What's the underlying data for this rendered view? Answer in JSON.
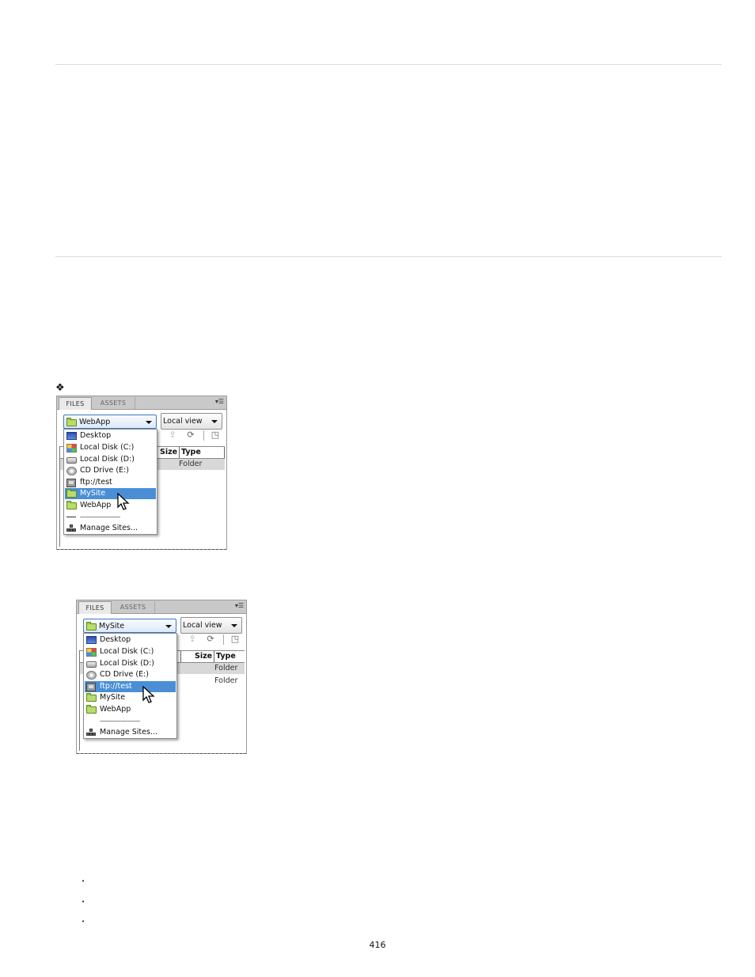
{
  "panel1": {
    "tab_files": "FILES",
    "tab_assets": "ASSETS",
    "site_value": "WebApp",
    "view_value": "Local view",
    "col_size": "Size",
    "col_type": "Type",
    "rows": [
      {
        "type": "Folder"
      }
    ],
    "dropdown": [
      {
        "label": "Desktop",
        "icon": "desktop-icon"
      },
      {
        "label": "Local Disk (C:)",
        "icon": "local-disk-icon"
      },
      {
        "label": "Local Disk (D:)",
        "icon": "local-disk-icon"
      },
      {
        "label": "CD Drive (E:)",
        "icon": "cd-drive-icon"
      },
      {
        "label": "ftp://test",
        "icon": "ftp-server-icon"
      },
      {
        "label": "MySite",
        "icon": "site-folder-icon",
        "highlighted": true
      },
      {
        "label": "WebApp",
        "icon": "site-folder-icon"
      }
    ],
    "separator": "-------------------------",
    "manage_sites": "Manage Sites..."
  },
  "panel2": {
    "tab_files": "FILES",
    "tab_assets": "ASSETS",
    "site_value": "MySite",
    "view_value": "Local view",
    "col_size": "Size",
    "col_type": "Type",
    "rows": [
      {
        "type": "Folder"
      },
      {
        "type": "Folder"
      }
    ],
    "dropdown": [
      {
        "label": "Desktop",
        "icon": "desktop-icon"
      },
      {
        "label": "Local Disk (C:)",
        "icon": "local-disk-icon"
      },
      {
        "label": "Local Disk (D:)",
        "icon": "local-disk-icon"
      },
      {
        "label": "CD Drive (E:)",
        "icon": "cd-drive-icon"
      },
      {
        "label": "ftp://test",
        "icon": "ftp-server-icon",
        "highlighted": true
      },
      {
        "label": "MySite",
        "icon": "site-folder-icon"
      },
      {
        "label": "WebApp",
        "icon": "site-folder-icon"
      }
    ],
    "separator": "-------------------------",
    "manage_sites": "Manage Sites..."
  },
  "colors": {
    "highlight": "#4a8fd6",
    "rule": "#dcdcdc"
  },
  "marker": "❖",
  "bullet": "•",
  "page_number": "416"
}
